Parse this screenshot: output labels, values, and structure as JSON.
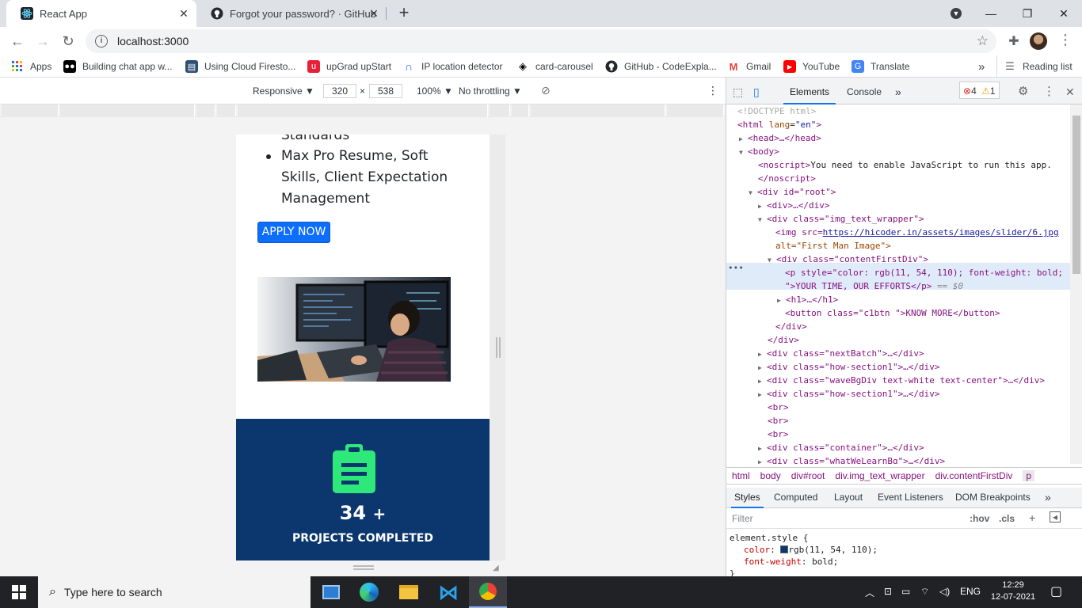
{
  "browser": {
    "tabs": [
      {
        "title": "React App",
        "active": true,
        "icon": "react-icon"
      },
      {
        "title": "Forgot your password? · GitHub",
        "active": false,
        "icon": "github-icon"
      }
    ],
    "url": "localhost:3000",
    "bookmarks": [
      {
        "label": "Apps",
        "icon": "apps-grid-icon"
      },
      {
        "label": "Building chat app w...",
        "icon": "medium-icon"
      },
      {
        "label": "Using Cloud Firesto...",
        "icon": "firestore-icon"
      },
      {
        "label": "upGrad upStart",
        "icon": "upgrad-icon"
      },
      {
        "label": "IP location detector",
        "icon": "ip-icon"
      },
      {
        "label": "card-carousel",
        "icon": "codepen-icon"
      },
      {
        "label": "GitHub - CodeExpla...",
        "icon": "github-icon"
      },
      {
        "label": "Gmail",
        "icon": "gmail-icon"
      },
      {
        "label": "YouTube",
        "icon": "youtube-icon"
      },
      {
        "label": "Translate",
        "icon": "translate-icon"
      }
    ],
    "reading_list": "Reading list",
    "more_bookmarks": "»"
  },
  "device_toolbar": {
    "device": "Responsive ▼",
    "width": "320",
    "times": "×",
    "height": "538",
    "zoom": "100% ▼",
    "throttle": "No throttling ▼"
  },
  "page": {
    "list_items": [
      "Standards",
      "Max Pro Resume, Soft",
      "Skills, Client Expectation",
      "Management"
    ],
    "apply_button": "APPLY NOW",
    "image_alt": "developer coding at computer",
    "stat_number": "34",
    "stat_plus": "+",
    "stat_label": "PROJECTS COMPLETED",
    "stat_icon": "clipboard-icon"
  },
  "devtools": {
    "tabs": [
      "Elements",
      "Console",
      "»"
    ],
    "errors": "4",
    "warnings": "1",
    "tree": {
      "doctype": "<!DOCTYPE html>",
      "html_open_tag": "<html",
      "lang_attr": "lang",
      "lang_val": "\"en\"",
      "close_bracket": ">",
      "head": "<head>…</head>",
      "body": "<body>",
      "noscript_tag": "<noscript>",
      "noscript_text": "You need to enable JavaScript to run this app.",
      "noscript_close": "</noscript>",
      "root_div": "<div id=\"root\">",
      "div_collapsed": "<div>…</div>",
      "wrapper_div": "<div class=\"img_text_wrapper\">",
      "img_tag": "<img src=",
      "img_src": "https://hicoder.in/assets/images/slider/6.jpg",
      "img_alt": "alt=\"First Man Image\">",
      "content_div": "<div class=\"contentFirstDiv\">",
      "p_line1": "<p style=\"color: rgb(11, 54, 110); font-weight: bold;",
      "p_line2": "\">YOUR TIME, OUR EFFORTS</p>",
      "p_eq": "== $0",
      "h1": "<h1>…</h1>",
      "button": "<button class=\"c1btn \">KNOW MORE</button>",
      "close_div1": "</div>",
      "close_div2": "</div>",
      "next_batch": "<div class=\"nextBatch\">…</div>",
      "how_section1": "<div class=\"how-section1\">…</div>",
      "wave_div": "<div class=\"waveBgDiv text-white text-center\">…</div>",
      "how_section2": "<div class=\"how-section1\">…</div>",
      "br1": "<br>",
      "br2": "<br>",
      "br3": "<br>",
      "container": "<div class=\"container\">…</div>",
      "what_we_learn": "<div class=\"whatWeLearnBg\">…</div>",
      "ellipsis": "•••"
    },
    "breadcrumbs": [
      "html",
      "body",
      "div#root",
      "div.img_text_wrapper",
      "div.contentFirstDiv",
      "p"
    ],
    "styles_tabs": [
      "Styles",
      "Computed",
      "Layout",
      "Event Listeners",
      "DOM Breakpoints",
      "»"
    ],
    "filter_placeholder": "Filter",
    "hov": ":hov",
    "cls": ".cls",
    "element_style": "element.style {",
    "prop1_name": "color",
    "prop1_value": "rgb(11, 54, 110);",
    "prop1_swatch": "#0b366e",
    "prop2_name": "font-weight",
    "prop2_value": "bold;",
    "close_brace": "}"
  },
  "taskbar": {
    "search_placeholder": "Type here to search",
    "language": "ENG",
    "time": "12:29",
    "date": "12-07-2021"
  },
  "colors": {
    "accent": "#0d6efd",
    "stats_bg": "#0b366e",
    "clipboard": "#2ee87a"
  }
}
